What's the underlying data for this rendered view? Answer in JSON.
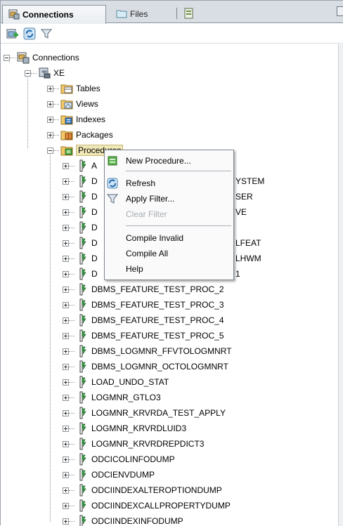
{
  "tabs": [
    {
      "label": "Connections",
      "active": true
    },
    {
      "label": "Files",
      "active": false
    }
  ],
  "toolbar": {
    "buttons": [
      "add-connection-icon",
      "refresh-icon",
      "filter-icon"
    ]
  },
  "tree": {
    "root": "Connections",
    "connection": "XE",
    "categories": [
      "Tables",
      "Views",
      "Indexes",
      "Packages",
      "Procedures"
    ],
    "procedures_visible_under_menu": [
      {
        "visible": "A",
        "tail": ""
      },
      {
        "visible": "D",
        "tail": "YSTEM"
      },
      {
        "visible": "D",
        "tail": "SER"
      },
      {
        "visible": "D",
        "tail": "VE"
      },
      {
        "visible": "D",
        "tail": ""
      },
      {
        "visible": "D",
        "tail": "LFEAT"
      },
      {
        "visible": "D",
        "tail": "LHWM"
      },
      {
        "visible": "D",
        "tail": "1"
      }
    ],
    "procedures": [
      "DBMS_FEATURE_TEST_PROC_2",
      "DBMS_FEATURE_TEST_PROC_3",
      "DBMS_FEATURE_TEST_PROC_4",
      "DBMS_FEATURE_TEST_PROC_5",
      "DBMS_LOGMNR_FFVTOLOGMNRT",
      "DBMS_LOGMNR_OCTOLOGMNRT",
      "LOAD_UNDO_STAT",
      "LOGMNR_GTLO3",
      "LOGMNR_KRVRDA_TEST_APPLY",
      "LOGMNR_KRVRDLUID3",
      "LOGMNR_KRVRDREPDICT3",
      "ODCICOLINFODUMP",
      "ODCIENVDUMP",
      "ODCIINDEXALTEROPTIONDUMP",
      "ODCIINDEXCALLPROPERTYDUMP",
      "ODCIINDEXINFODUMP"
    ]
  },
  "context_menu": {
    "items": [
      {
        "label": "New Procedure...",
        "icon": "new-procedure-icon",
        "enabled": true
      },
      {
        "label": "Refresh",
        "icon": "refresh-icon",
        "enabled": true
      },
      {
        "label": "Apply Filter...",
        "icon": "filter-icon",
        "enabled": true
      },
      {
        "label": "Clear Filter",
        "icon": "",
        "enabled": false
      },
      {
        "label": "Compile Invalid",
        "icon": "",
        "enabled": true
      },
      {
        "label": "Compile All",
        "icon": "",
        "enabled": true
      },
      {
        "label": "Help",
        "icon": "",
        "enabled": true
      }
    ]
  }
}
